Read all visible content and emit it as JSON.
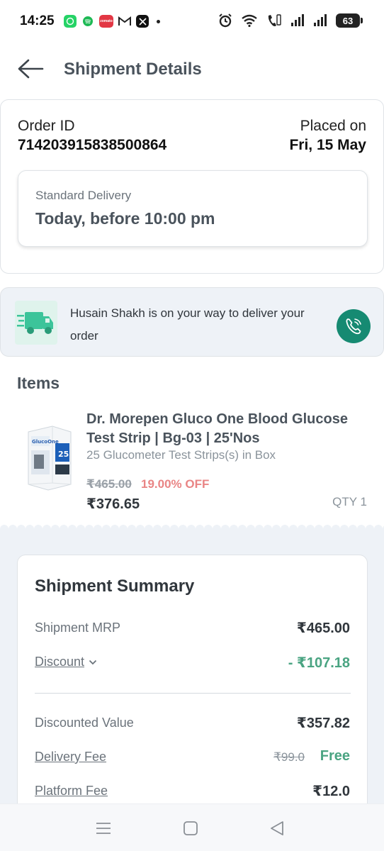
{
  "status_bar": {
    "time": "14:25",
    "battery": "63",
    "app_icons": [
      "whatsapp-icon",
      "spotify-icon",
      "zomato-icon",
      "gmail-icon",
      "x-icon"
    ],
    "zomato_label": "zomato"
  },
  "header": {
    "title": "Shipment Details"
  },
  "order": {
    "id_label": "Order ID",
    "id_value": "714203915838500864",
    "placed_label": "Placed on",
    "placed_value": "Fri, 15 May",
    "delivery_type": "Standard Delivery",
    "delivery_time": "Today, before 10:00 pm"
  },
  "courier": {
    "message": "Husain Shakh is on your way to deliver your order"
  },
  "items": {
    "title": "Items",
    "list": [
      {
        "name": "Dr. Morepen Gluco One Blood Glucose Test Strip | Bg-03 | 25'Nos",
        "variant": "25 Glucometer Test Strips(s) in Box",
        "mrp": "₹465.00",
        "discount": "19.00% OFF",
        "price": "₹376.65",
        "qty": "QTY 1",
        "box_brand": "GlucoOne",
        "box_count": "25"
      }
    ]
  },
  "summary": {
    "title": "Shipment Summary",
    "mrp_label": "Shipment MRP",
    "mrp_value": "₹465.00",
    "discount_label": "Discount",
    "discount_value": "- ₹107.18",
    "discounted_label": "Discounted Value",
    "discounted_value": "₹357.82",
    "delivery_label": "Delivery Fee",
    "delivery_old": "₹99.0",
    "delivery_value": "Free",
    "platform_label": "Platform Fee",
    "platform_value": "₹12.0"
  },
  "colors": {
    "accent_green": "#168a72",
    "discount_green": "#4aa482",
    "off_red": "#e98585"
  }
}
